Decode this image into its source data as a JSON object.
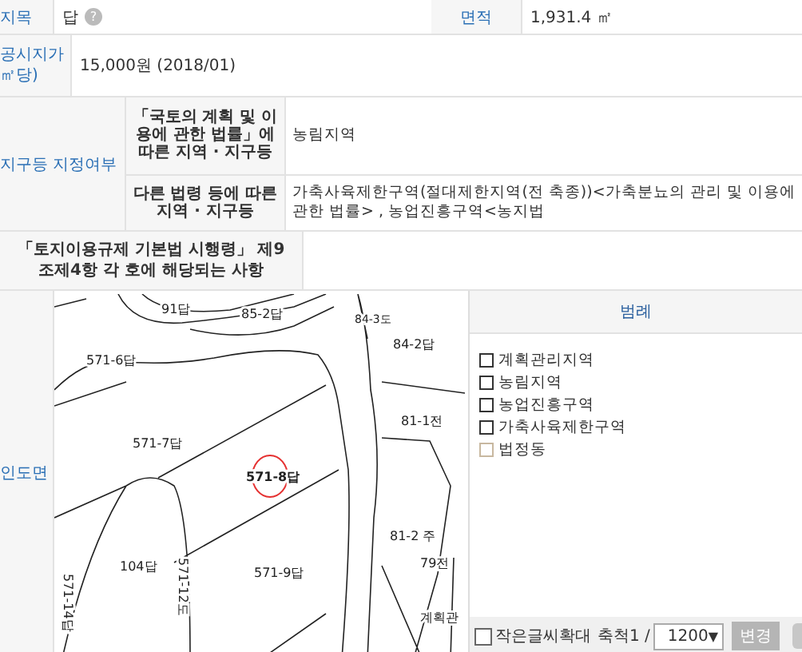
{
  "parcel": {
    "category": {
      "label": "지목",
      "value": "답",
      "help": "?"
    },
    "area": {
      "label": "면적",
      "value": "1,931.4 ㎡"
    }
  },
  "official_price": {
    "label_lines": [
      "공시지가",
      "㎡당)"
    ],
    "value": "15,000원 (2018/01)"
  },
  "zoning": {
    "label": "지구등 지정여부",
    "rows": [
      {
        "label": "「국토의 계획 및 이용에 관한 법률」에 따른 지역 · 지구등",
        "value": "농림지역"
      },
      {
        "label": "다른 법령 등에 따른 지역 · 지구등",
        "value": "가축사육제한구역(절대제한지역(전 축종))<가축분뇨의 관리 및 이용에 관한 법률> , 농업진흥구역<농지법"
      }
    ]
  },
  "regulation": {
    "label": "「토지이용규제 기본법 시행령」 제9조제4항 각 호에 해당되는 사항"
  },
  "map_section": {
    "label": "인도면",
    "map_labels": [
      {
        "text": "91답"
      },
      {
        "text": "85-2답"
      },
      {
        "text": "84-3도"
      },
      {
        "text": "84-2답"
      },
      {
        "text": "571-6답"
      },
      {
        "text": "81-1전"
      },
      {
        "text": "571-7답"
      },
      {
        "text": "571-8답",
        "selected": true
      },
      {
        "text": "81-2 주"
      },
      {
        "text": "571-14답"
      },
      {
        "text": "104답"
      },
      {
        "text": "571-12도"
      },
      {
        "text": "571-9답"
      },
      {
        "text": "79전"
      },
      {
        "text": "계획관"
      }
    ],
    "legend": {
      "title": "범례",
      "items": [
        {
          "label": "계획관리지역",
          "checked": false,
          "color": "#333333"
        },
        {
          "label": "농림지역",
          "checked": false,
          "color": "#333333"
        },
        {
          "label": "농업진흥구역",
          "checked": false,
          "color": "#333333"
        },
        {
          "label": "가축사육제한구역",
          "checked": false,
          "color": "#333333"
        },
        {
          "label": "법정동",
          "checked": false,
          "color": "#c8b8a0"
        }
      ]
    },
    "controls": {
      "zoom_text": {
        "label": "작은글씨확대",
        "checked": false
      },
      "scale_label": "축척1 /",
      "scale_value": "1200",
      "caret": "▼",
      "apply_button": "변경"
    }
  }
}
